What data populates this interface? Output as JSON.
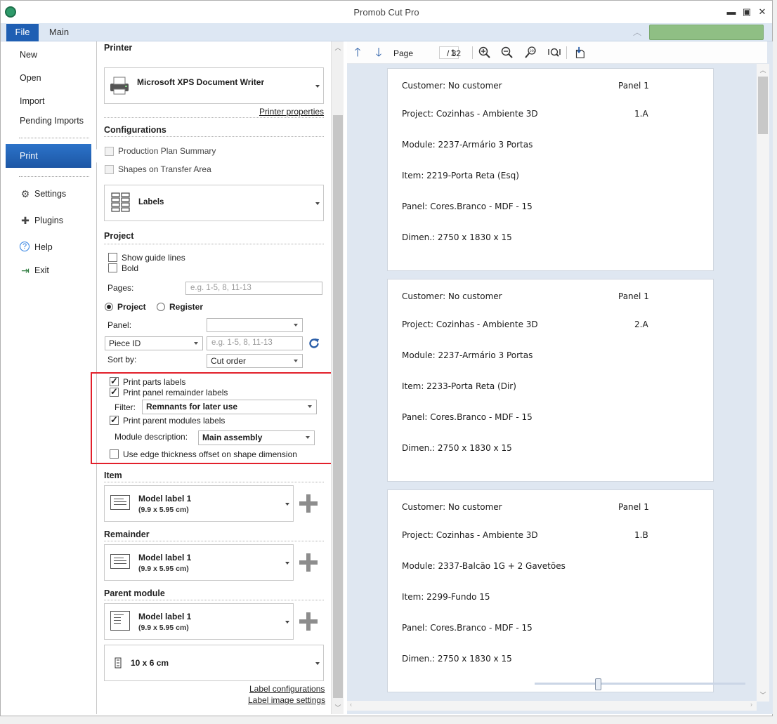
{
  "window": {
    "title": "Promob Cut Pro",
    "colors": {
      "accent": "#1f5fb3",
      "status_green": "#8fbf84",
      "highlight_box": "#e2202b"
    }
  },
  "ribbon": {
    "file_tab": "File",
    "main_tab": "Main"
  },
  "nav": {
    "new": "New",
    "open": "Open",
    "import": "Import",
    "pending_imports": "Pending Imports",
    "print": "Print",
    "settings": "Settings",
    "plugins": "Plugins",
    "help": "Help",
    "exit": "Exit"
  },
  "printer": {
    "heading": "Printer",
    "selected": "Microsoft XPS Document Writer",
    "properties_link": "Printer properties"
  },
  "configurations": {
    "heading": "Configurations",
    "production_plan_summary": "Production Plan Summary",
    "shapes_on_transfer_area": "Shapes on Transfer Area",
    "report_type": "Labels"
  },
  "project": {
    "heading": "Project",
    "show_guide_lines": "Show guide lines",
    "bold": "Bold",
    "pages_label": "Pages:",
    "pages_placeholder": "e.g. 1-5, 8, 11-13",
    "radio_project": "Project",
    "radio_register": "Register",
    "panel_label": "Panel:",
    "panel_value": "",
    "piece_field": "Piece ID",
    "piece_placeholder": "e.g. 1-5, 8, 11-13",
    "sort_label": "Sort by:",
    "sort_value": "Cut order"
  },
  "label_options": {
    "print_parts_labels": "Print parts labels",
    "print_panel_remainder_labels": "Print panel remainder labels",
    "filter_label": "Filter:",
    "filter_value": "Remnants for later use",
    "print_parent_modules_labels": "Print parent modules labels",
    "module_description_label": "Module description:",
    "module_description_value": "Main assembly",
    "use_edge_thickness": "Use edge thickness offset on shape dimension"
  },
  "item": {
    "heading": "Item",
    "model": "Model label 1",
    "size": "(9.9 x 5.95 cm)"
  },
  "remainder": {
    "heading": "Remainder",
    "model": "Model label 1",
    "size": "(9.9 x 5.95 cm)"
  },
  "parent_module": {
    "heading": "Parent module",
    "model": "Model label 1",
    "size": "(9.9 x 5.95 cm)"
  },
  "paper": {
    "size": "10 x 6 cm"
  },
  "bottom_links": {
    "label_configurations": "Label configurations",
    "label_image_settings": "Label image settings"
  },
  "preview": {
    "page_label": "Page",
    "current_page": "1",
    "total_pages": "/  32",
    "zoom_fraction": 0.3,
    "labels": [
      {
        "customer": "Customer: No customer",
        "panel": "Panel 1",
        "project": "Project: Cozinhas - Ambiente 3D",
        "code": "1.A",
        "module": "Module: 2237-Armário 3 Portas",
        "item": "Item: 2219-Porta Reta (Esq)",
        "panel_material": "Panel: Cores.Branco - MDF - 15",
        "dimen": "Dimen.: 2750 x 1830 x 15"
      },
      {
        "customer": "Customer: No customer",
        "panel": "Panel 1",
        "project": "Project: Cozinhas - Ambiente 3D",
        "code": "2.A",
        "module": "Module: 2237-Armário 3 Portas",
        "item": "Item: 2233-Porta Reta (Dir)",
        "panel_material": "Panel: Cores.Branco - MDF - 15",
        "dimen": "Dimen.: 2750 x 1830 x 15"
      },
      {
        "customer": "Customer: No customer",
        "panel": "Panel 1",
        "project": "Project: Cozinhas - Ambiente 3D",
        "code": "1.B",
        "module": "Module: 2337-Balcão 1G + 2 Gavetões",
        "item": "Item: 2299-Fundo 15",
        "panel_material": "Panel: Cores.Branco - MDF - 15",
        "dimen": "Dimen.: 2750 x 1830 x 15"
      }
    ]
  },
  "icons": [
    "app-icon",
    "minimize-icon",
    "maximize-icon",
    "close-icon",
    "collapse-ribbon-icon",
    "gear-icon",
    "puzzle-icon",
    "help-icon",
    "exit-icon",
    "printer-icon",
    "labels-grid-icon",
    "refresh-icon",
    "label-model-icon",
    "plus-icon",
    "arrow-up-icon",
    "arrow-down-icon",
    "zoom-in-icon",
    "zoom-out-icon",
    "zoom-100-icon",
    "zoom-fit-icon",
    "export-icon"
  ]
}
